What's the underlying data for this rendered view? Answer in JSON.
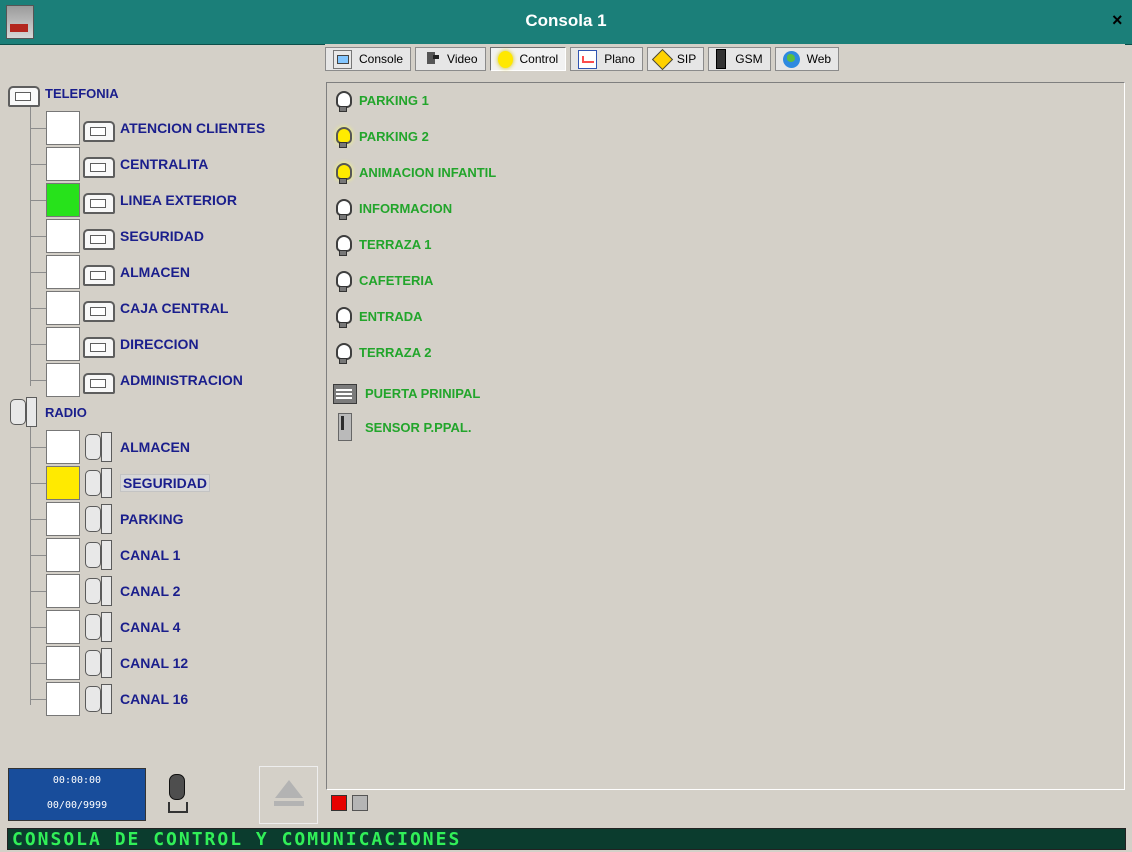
{
  "window": {
    "title": "Consola 1"
  },
  "toolbar": {
    "items": [
      {
        "label": "Console",
        "icon": "console-icon"
      },
      {
        "label": "Video",
        "icon": "video-icon"
      },
      {
        "label": "Control",
        "icon": "bulb-icon",
        "active": true
      },
      {
        "label": "Plano",
        "icon": "plano-icon"
      },
      {
        "label": "SIP",
        "icon": "sip-icon"
      },
      {
        "label": "GSM",
        "icon": "gsm-icon"
      },
      {
        "label": "Web",
        "icon": "web-icon"
      }
    ]
  },
  "tree": {
    "telefonia": {
      "label": "TELEFONIA",
      "items": [
        {
          "label": "ATENCION CLIENTES",
          "status": "white"
        },
        {
          "label": "CENTRALITA",
          "status": "white"
        },
        {
          "label": "LINEA EXTERIOR",
          "status": "green"
        },
        {
          "label": "SEGURIDAD",
          "status": "white"
        },
        {
          "label": "ALMACEN",
          "status": "white"
        },
        {
          "label": "CAJA CENTRAL",
          "status": "white"
        },
        {
          "label": "DIRECCION",
          "status": "white"
        },
        {
          "label": "ADMINISTRACION",
          "status": "white"
        }
      ]
    },
    "radio": {
      "label": "RADIO",
      "items": [
        {
          "label": "ALMACEN",
          "status": "white"
        },
        {
          "label": "SEGURIDAD",
          "status": "yellow",
          "selected": true
        },
        {
          "label": "PARKING",
          "status": "white"
        },
        {
          "label": "CANAL 1",
          "status": "white"
        },
        {
          "label": "CANAL 2",
          "status": "white"
        },
        {
          "label": "CANAL 4",
          "status": "white"
        },
        {
          "label": "CANAL 12",
          "status": "white"
        },
        {
          "label": "CANAL 16",
          "status": "white"
        }
      ]
    }
  },
  "controls": [
    {
      "label": "PARKING 1",
      "icon": "bulb",
      "lit": false
    },
    {
      "label": "PARKING 2",
      "icon": "bulb",
      "lit": true
    },
    {
      "label": "ANIMACION INFANTIL",
      "icon": "bulb",
      "lit": true
    },
    {
      "label": "INFORMACION",
      "icon": "bulb",
      "lit": false
    },
    {
      "label": "TERRAZA 1",
      "icon": "bulb",
      "lit": false
    },
    {
      "label": "CAFETERIA",
      "icon": "bulb",
      "lit": false
    },
    {
      "label": "ENTRADA",
      "icon": "bulb",
      "lit": false
    },
    {
      "label": "TERRAZA 2",
      "icon": "bulb",
      "lit": false
    },
    {
      "label": "PUERTA PRINIPAL",
      "icon": "gate"
    },
    {
      "label": "SENSOR P.PPAL.",
      "icon": "sensor"
    }
  ],
  "status": {
    "time": "00:00:00",
    "date": "00/00/9999"
  },
  "ticker": {
    "text": "CONSOLA DE CONTROL Y COMUNICACIONES"
  },
  "colors": {
    "title_bar": "#1b7f79",
    "label_blue": "#1a1e8c",
    "control_green": "#22a52b",
    "ticker_bg": "#0b3c2e",
    "ticker_text": "#31ef58",
    "status_green": "#27e21b",
    "status_yellow": "#ffea00"
  }
}
